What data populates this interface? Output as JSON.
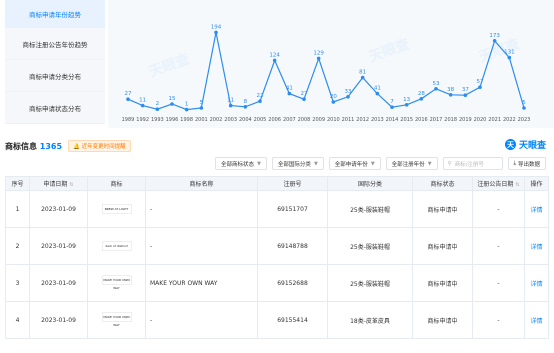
{
  "side_nav": [
    {
      "label": "商标申请年份趋势",
      "active": true
    },
    {
      "label": "商标注册公告年份趋势",
      "active": false
    },
    {
      "label": "商标申请分类分布",
      "active": false
    },
    {
      "label": "商标申请状态分布",
      "active": false
    }
  ],
  "watermark": "天眼查",
  "chart_data": {
    "type": "line",
    "categories": [
      "1989",
      "1992",
      "1993",
      "1996",
      "1998",
      "2001",
      "2002",
      "2003",
      "2004",
      "2005",
      "2006",
      "2007",
      "2008",
      "2009",
      "2010",
      "2011",
      "2012",
      "2013",
      "2014",
      "2015",
      "2016",
      "2017",
      "2018",
      "2019",
      "2020",
      "2021",
      "2022",
      "2023"
    ],
    "values": [
      27,
      11,
      2,
      15,
      1,
      5,
      194,
      11,
      8,
      22,
      124,
      41,
      27,
      129,
      20,
      33,
      81,
      41,
      7,
      13,
      28,
      53,
      38,
      37,
      57,
      173,
      131,
      5
    ],
    "title": "",
    "xlabel": "",
    "ylabel": "",
    "ylim": [
      0,
      200
    ],
    "color": "#2d8cf0",
    "grid": false
  },
  "info": {
    "title": "商标信息",
    "count": "1365",
    "warn": "近年变更时间提醒"
  },
  "logo": {
    "mark": "天",
    "text": "天眼查"
  },
  "filters": [
    "全部商标状态",
    "全部国际分类",
    "全部申请年份",
    "全部注册年份"
  ],
  "search": {
    "placeholder": "商标/注册号"
  },
  "export": "导出数据",
  "table": {
    "headers": [
      "序号",
      "申请日期",
      "商标",
      "商标名称",
      "注册号",
      "国际分类",
      "商标状态",
      "注册公告日期",
      "操作"
    ],
    "rows": [
      {
        "no": "1",
        "date": "2023-01-09",
        "logo": "BREW AT LIGHT",
        "name": "-",
        "reg": "69151707",
        "cls": "25类-服装鞋帽",
        "status": "商标申请中",
        "pub": "-",
        "op": "详情"
      },
      {
        "no": "2",
        "date": "2023-01-09",
        "logo": "dark of distinct",
        "name": "-",
        "reg": "69148788",
        "cls": "25类-服装鞋帽",
        "status": "商标申请中",
        "pub": "-",
        "op": "详情"
      },
      {
        "no": "3",
        "date": "2023-01-09",
        "logo": "MAKE YOUR OWN WAY",
        "name": "MAKE YOUR OWN WAY",
        "reg": "69152688",
        "cls": "25类-服装鞋帽",
        "status": "商标申请中",
        "pub": "-",
        "op": "详情"
      },
      {
        "no": "4",
        "date": "2023-01-09",
        "logo": "MAKE YOUR OWN WAY",
        "name": "-",
        "reg": "69155414",
        "cls": "18类-皮革皮具",
        "status": "商标申请中",
        "pub": "-",
        "op": "详情"
      }
    ]
  }
}
